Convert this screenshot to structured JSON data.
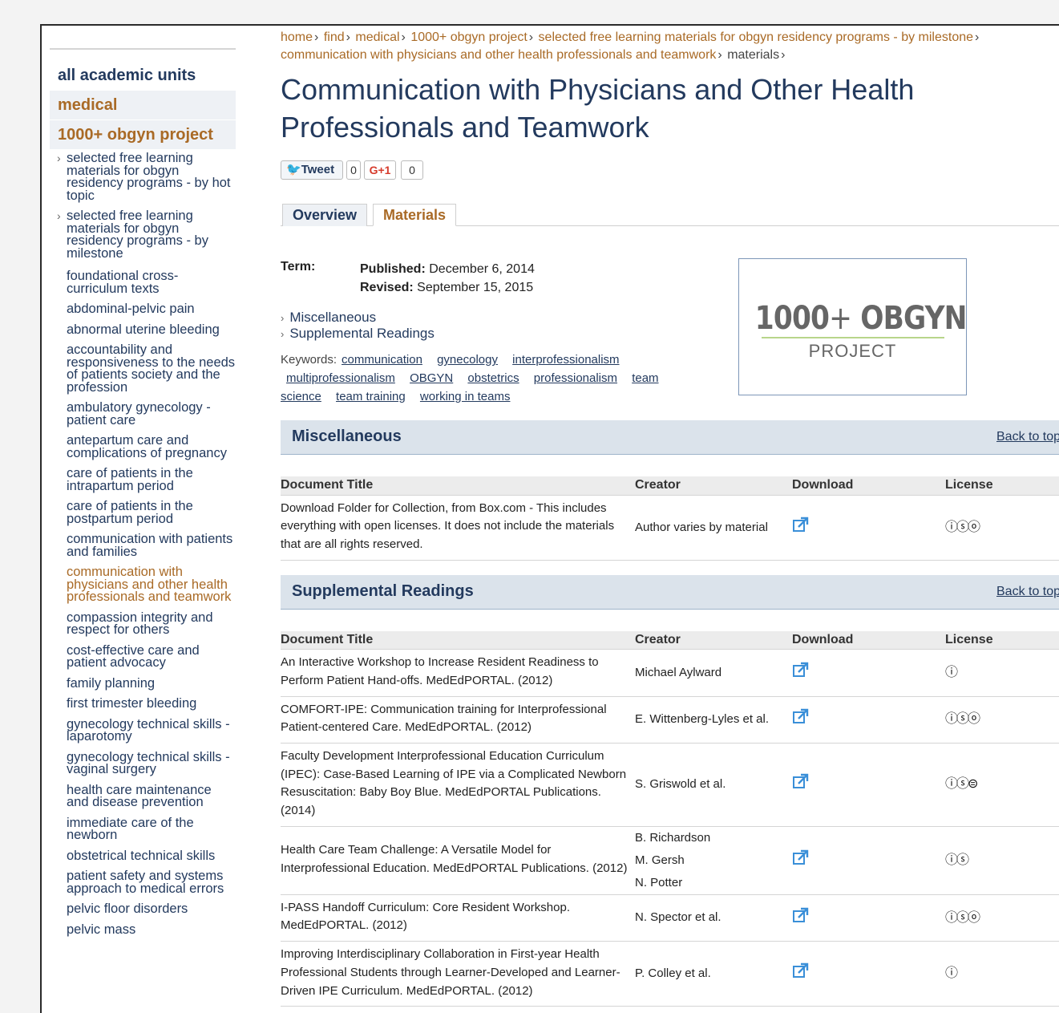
{
  "sidebar": {
    "all_units": "all academic units",
    "unit_medical": "medical",
    "unit_project": "1000+ obgyn project",
    "items": [
      {
        "label": "selected free learning materials for obgyn residency programs - by hot topic",
        "arrow": true
      },
      {
        "label": "selected free learning materials for obgyn residency programs - by milestone",
        "arrow": true
      },
      {
        "label": "foundational cross-curriculum texts"
      },
      {
        "label": "abdominal-pelvic pain"
      },
      {
        "label": "abnormal uterine bleeding"
      },
      {
        "label": "accountability and responsiveness to the needs of patients society and the profession"
      },
      {
        "label": "ambulatory gynecology - patient care"
      },
      {
        "label": "antepartum care and complications of pregnancy"
      },
      {
        "label": "care of patients in the intrapartum period"
      },
      {
        "label": "care of patients in the postpartum period"
      },
      {
        "label": "communication with patients and families"
      },
      {
        "label": "communication with physicians and other health professionals and teamwork",
        "active": true
      },
      {
        "label": "compassion integrity and respect for others"
      },
      {
        "label": "cost-effective care and patient advocacy"
      },
      {
        "label": "family planning"
      },
      {
        "label": "first trimester bleeding"
      },
      {
        "label": "gynecology technical skills - laparotomy"
      },
      {
        "label": "gynecology technical skills - vaginal surgery"
      },
      {
        "label": "health care maintenance and disease prevention"
      },
      {
        "label": "immediate care of the newborn"
      },
      {
        "label": "obstetrical technical skills"
      },
      {
        "label": "patient safety and systems approach to medical errors"
      },
      {
        "label": "pelvic floor disorders"
      },
      {
        "label": "pelvic mass"
      }
    ]
  },
  "breadcrumb": {
    "items": [
      "home",
      "find",
      "medical",
      "1000+ obgyn project",
      "selected free learning materials for obgyn residency programs - by milestone",
      "communication with physicians and other health professionals and teamwork"
    ],
    "last": "materials",
    "separator": "›"
  },
  "title": "Communication with Physicians and Other Health Professionals and Teamwork",
  "social": {
    "tweet_label": "Tweet",
    "tweet_count": "0",
    "gplus_label": "G+1",
    "gplus_count": "0"
  },
  "tabs": {
    "overview": "Overview",
    "materials": "Materials"
  },
  "info": {
    "term_label": "Term:",
    "published_label": "Published:",
    "published_value": "December 6, 2014",
    "revised_label": "Revised:",
    "revised_value": "September 15, 2015",
    "toc": [
      "Miscellaneous",
      "Supplemental Readings"
    ],
    "keywords_label": "Keywords:",
    "keywords": [
      "communication",
      "gynecology",
      "interprofessionalism",
      "multiprofessionalism",
      "OBGYN",
      "obstetrics",
      "professionalism",
      "team science",
      "team training",
      "working in teams"
    ]
  },
  "logo": {
    "main_bold": "1000",
    "main_plus": "+",
    "main_rest": "OBGYN",
    "sub": "PROJECT"
  },
  "table_headers": {
    "title": "Document Title",
    "creator": "Creator",
    "download": "Download",
    "license": "License"
  },
  "back_to_top": "Back to top",
  "sections": [
    {
      "name": "Miscellaneous",
      "rows": [
        {
          "title": "Download Folder for Collection, from Box.com - This includes everything with open licenses. It does not include the materials that are all rights reserved.",
          "creators": [
            "Author varies by material"
          ],
          "license": "ⓘⓢⓞ"
        }
      ]
    },
    {
      "name": "Supplemental Readings",
      "rows": [
        {
          "title": "An Interactive Workshop to Increase Resident Readiness to Perform Patient Hand-offs. MedEdPORTAL. (2012)",
          "creators": [
            "Michael Aylward"
          ],
          "license": "ⓘ"
        },
        {
          "title": "COMFORT-IPE: Communication training for Interprofessional Patient-centered Care. MedEdPORTAL. (2012)",
          "creators": [
            "E. Wittenberg-Lyles et al."
          ],
          "license": "ⓘⓢⓞ"
        },
        {
          "title": "Faculty Development Interprofessional Education Curriculum (IPEC): Case-Based Learning of IPE via a Complicated Newborn Resuscitation: Baby Boy Blue. MedEdPORTAL Publications. (2014)",
          "creators": [
            "S. Griswold et al."
          ],
          "license": "ⓘⓢ⊜"
        },
        {
          "title": "Health Care Team Challenge: A Versatile Model for Interprofessional Education. MedEdPORTAL Publications. (2012)",
          "creators": [
            "B. Richardson",
            "M. Gersh",
            "N. Potter"
          ],
          "license": "ⓘⓢ"
        },
        {
          "title": "I-PASS Handoff Curriculum: Core Resident Workshop. MedEdPORTAL. (2012)",
          "creators": [
            "N. Spector et al."
          ],
          "license": "ⓘⓢⓞ"
        },
        {
          "title": "Improving Interdisciplinary Collaboration in First-year Health Professional Students through Learner-Developed and Learner-Driven IPE Curriculum. MedEdPORTAL. (2012)",
          "creators": [
            "P. Colley et al."
          ],
          "license": "ⓘ"
        }
      ]
    }
  ]
}
